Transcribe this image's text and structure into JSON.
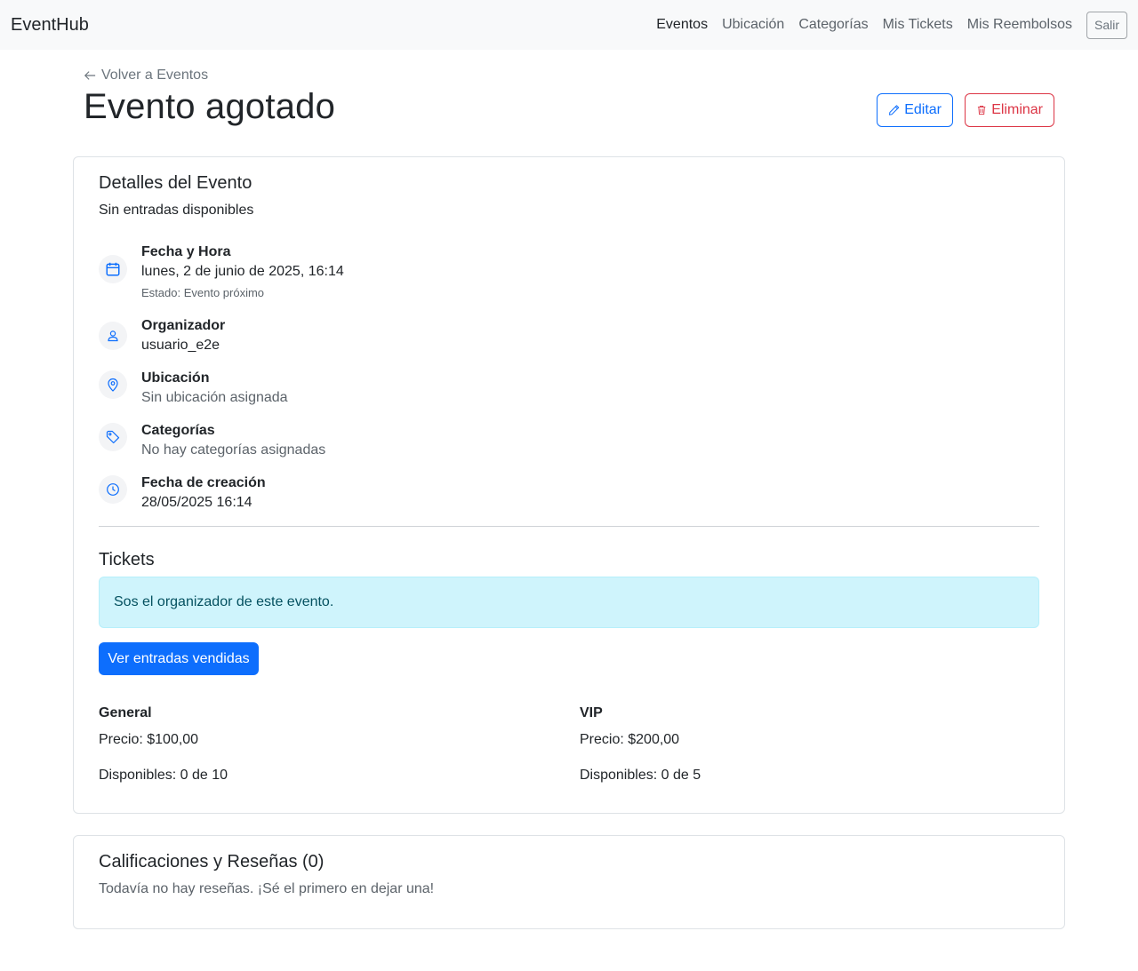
{
  "navbar": {
    "brand": "EventHub",
    "links": [
      "Eventos",
      "Ubicación",
      "Categorías",
      "Mis Tickets",
      "Mis Reembolsos"
    ],
    "logout": "Salir"
  },
  "header": {
    "back_link": "Volver a Eventos",
    "title": "Evento agotado",
    "edit_label": "Editar",
    "delete_label": "Eliminar"
  },
  "details": {
    "title": "Detalles del Evento",
    "subtitle": "Sin entradas disponibles",
    "items": [
      {
        "icon": "calendar-icon",
        "label": "Fecha y Hora",
        "value": "lunes, 2 de junio de 2025, 16:14",
        "extra": "Estado: Evento próximo"
      },
      {
        "icon": "person-icon",
        "label": "Organizador",
        "value": "usuario_e2e"
      },
      {
        "icon": "location-pin-icon",
        "label": "Ubicación",
        "value": "Sin ubicación asignada"
      },
      {
        "icon": "tag-icon",
        "label": "Categorías",
        "value": "No hay categorías asignadas"
      },
      {
        "icon": "clock-icon",
        "label": "Fecha de creación",
        "value": "28/05/2025 16:14"
      }
    ]
  },
  "tickets": {
    "title": "Tickets",
    "organizer_notice": "Sos el organizador de este evento.",
    "view_sold_button": "Ver entradas vendidas",
    "types": [
      {
        "name": "General",
        "price": "Precio: $100,00",
        "available": "Disponibles: 0 de 10"
      },
      {
        "name": "VIP",
        "price": "Precio: $200,00",
        "available": "Disponibles: 0 de 5"
      }
    ]
  },
  "reviews": {
    "title": "Calificaciones y Reseñas (0)",
    "empty_text": "Todavía no hay reseñas. ¡Sé el primero en dejar una!"
  },
  "colors": {
    "primary": "#0d6efd",
    "danger": "#dc3545",
    "info_bg": "#cff4fc",
    "info_text": "#055160"
  }
}
